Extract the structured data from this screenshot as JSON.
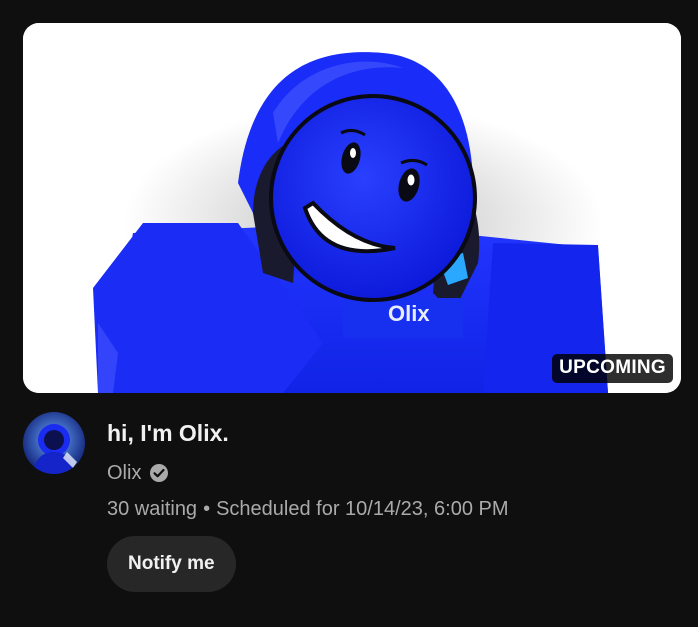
{
  "video": {
    "badge": "UPCOMING",
    "title": "hi, I'm Olix.",
    "channel": "Olix",
    "waiting": "30 waiting",
    "separator": "•",
    "scheduled": "Scheduled for 10/14/23, 6:00 PM",
    "thumbnail_text": "Olix",
    "verified_icon": "check-circle-icon"
  },
  "actions": {
    "notify_label": "Notify me"
  },
  "colors": {
    "background": "#0f0f0f",
    "primary_text": "#f1f1f1",
    "secondary_text": "#aaaaaa",
    "button_bg": "#272727",
    "character_blue": "#1c2cff"
  }
}
